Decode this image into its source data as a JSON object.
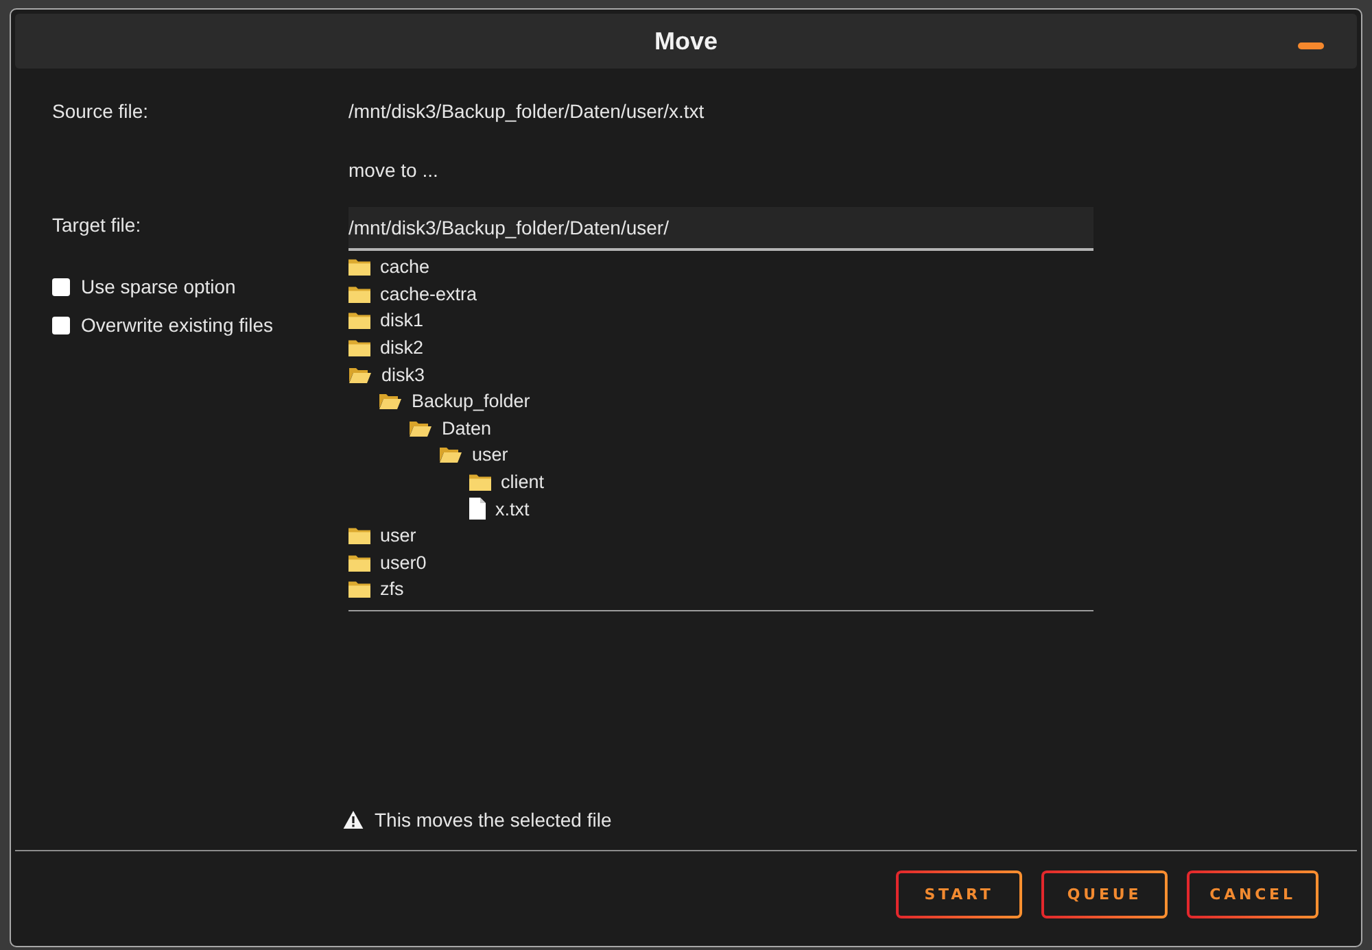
{
  "window": {
    "title": "Move"
  },
  "fields": {
    "source_label": "Source file:",
    "source_value": "/mnt/disk3/Backup_folder/Daten/user/x.txt",
    "move_to": "move to ...",
    "target_label": "Target file:",
    "target_value": "/mnt/disk3/Backup_folder/Daten/user/"
  },
  "options": [
    {
      "label": "Use sparse option",
      "checked": false
    },
    {
      "label": "Overwrite existing files",
      "checked": false
    }
  ],
  "tree": [
    {
      "name": "cache",
      "kind": "folder",
      "expanded": false
    },
    {
      "name": "cache-extra",
      "kind": "folder",
      "expanded": false
    },
    {
      "name": "disk1",
      "kind": "folder",
      "expanded": false
    },
    {
      "name": "disk2",
      "kind": "folder",
      "expanded": false
    },
    {
      "name": "disk3",
      "kind": "folder",
      "expanded": true,
      "children": [
        {
          "name": "Backup_folder",
          "kind": "folder",
          "expanded": true,
          "children": [
            {
              "name": "Daten",
              "kind": "folder",
              "expanded": true,
              "children": [
                {
                  "name": "user",
                  "kind": "folder",
                  "expanded": true,
                  "children": [
                    {
                      "name": "client",
                      "kind": "folder",
                      "expanded": false
                    },
                    {
                      "name": "x.txt",
                      "kind": "file"
                    }
                  ]
                }
              ]
            }
          ]
        }
      ]
    },
    {
      "name": "user",
      "kind": "folder",
      "expanded": false
    },
    {
      "name": "user0",
      "kind": "folder",
      "expanded": false
    },
    {
      "name": "zfs",
      "kind": "folder",
      "expanded": false
    }
  ],
  "notice": {
    "text": "This moves the selected file"
  },
  "buttons": [
    "START",
    "QUEUE",
    "CANCEL"
  ]
}
